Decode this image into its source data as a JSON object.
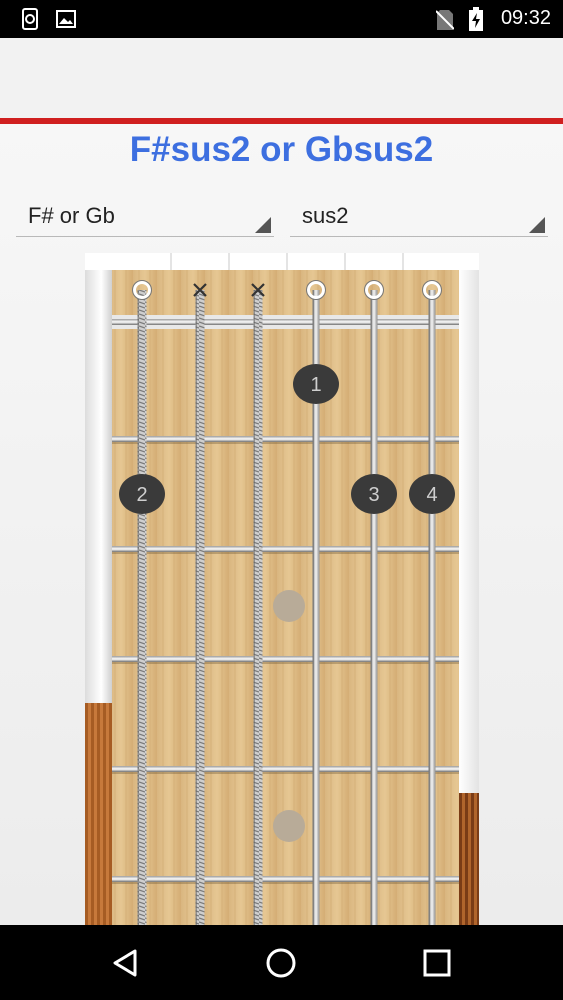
{
  "status_bar": {
    "time": "09:32",
    "icons": [
      "screen-rotation-icon",
      "image-icon",
      "no-sim-icon",
      "battery-charging-icon"
    ]
  },
  "chord": {
    "title": "F#sus2 or Gbsus2",
    "title_color": "#3d6fe0",
    "accent_color": "#d01f1f"
  },
  "root_select": {
    "value": "F# or Gb"
  },
  "type_select": {
    "value": "sus2"
  },
  "fretboard": {
    "strings": [
      {
        "open_marker": "O"
      },
      {
        "open_marker": "X"
      },
      {
        "open_marker": "X"
      },
      {
        "open_marker": "O"
      },
      {
        "open_marker": "O"
      },
      {
        "open_marker": "O"
      }
    ],
    "fingers": [
      {
        "label": "1",
        "string": 4,
        "fret": 1
      },
      {
        "label": "2",
        "string": 1,
        "fret": 2
      },
      {
        "label": "3",
        "string": 5,
        "fret": 2
      },
      {
        "label": "4",
        "string": 6,
        "fret": 2
      }
    ],
    "inlays": [
      3,
      5
    ]
  },
  "nav_bar": {
    "buttons": [
      "back-icon",
      "home-icon",
      "recents-icon"
    ]
  }
}
